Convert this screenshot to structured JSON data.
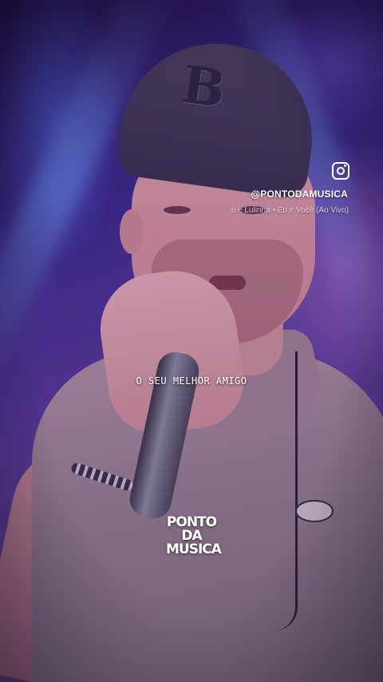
{
  "social": {
    "icon": "instagram-icon",
    "handle": "@PONTODAMUSICA",
    "track": "o e Lulinha • Eu e Você (Ao Vivo)"
  },
  "lyric": "O SEU MELHOR AMIGO",
  "logo": {
    "line1": "PONTO DA",
    "line2": "MUSICA"
  },
  "cap_logo": "B"
}
